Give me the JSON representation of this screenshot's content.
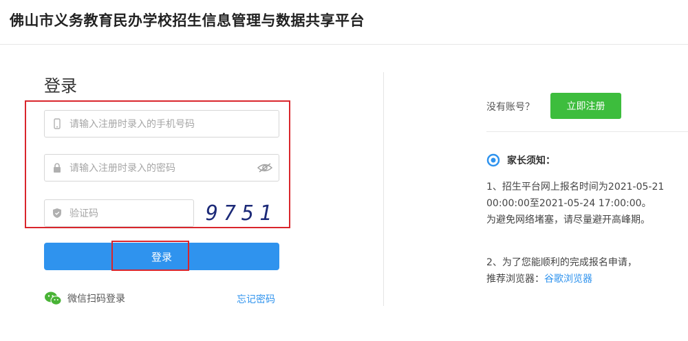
{
  "header": {
    "title": "佛山市义务教育民办学校招生信息管理与数据共享平台"
  },
  "login": {
    "title": "登录",
    "phone_placeholder": "请输入注册时录入的手机号码",
    "password_placeholder": "请输入注册时录入的密码",
    "captcha_placeholder": "验证码",
    "captcha_code": "9751",
    "login_button": "登录",
    "wechat_label": "微信扫码登录",
    "forgot_password": "忘记密码"
  },
  "register": {
    "prompt": "没有账号？",
    "button": "立即注册"
  },
  "notice": {
    "title": "家长须知：",
    "line1": "1、招生平台网上报名时间为2021-05-21",
    "line2": "00:00:00至2021-05-24 17:00:00。",
    "line3": "为避免网络堵塞，请尽量避开高峰期。",
    "line4": "2、为了您能顺利的完成报名申请，",
    "line5_prefix": "推荐浏览器：",
    "line5_link": "谷歌浏览器"
  },
  "colors": {
    "primary": "#2f93ee",
    "success": "#3dbd3d",
    "highlight": "#d9252b"
  },
  "icons": [
    "phone-icon",
    "lock-icon",
    "eye-off-icon",
    "shield-icon",
    "wechat-icon",
    "notice-icon"
  ]
}
